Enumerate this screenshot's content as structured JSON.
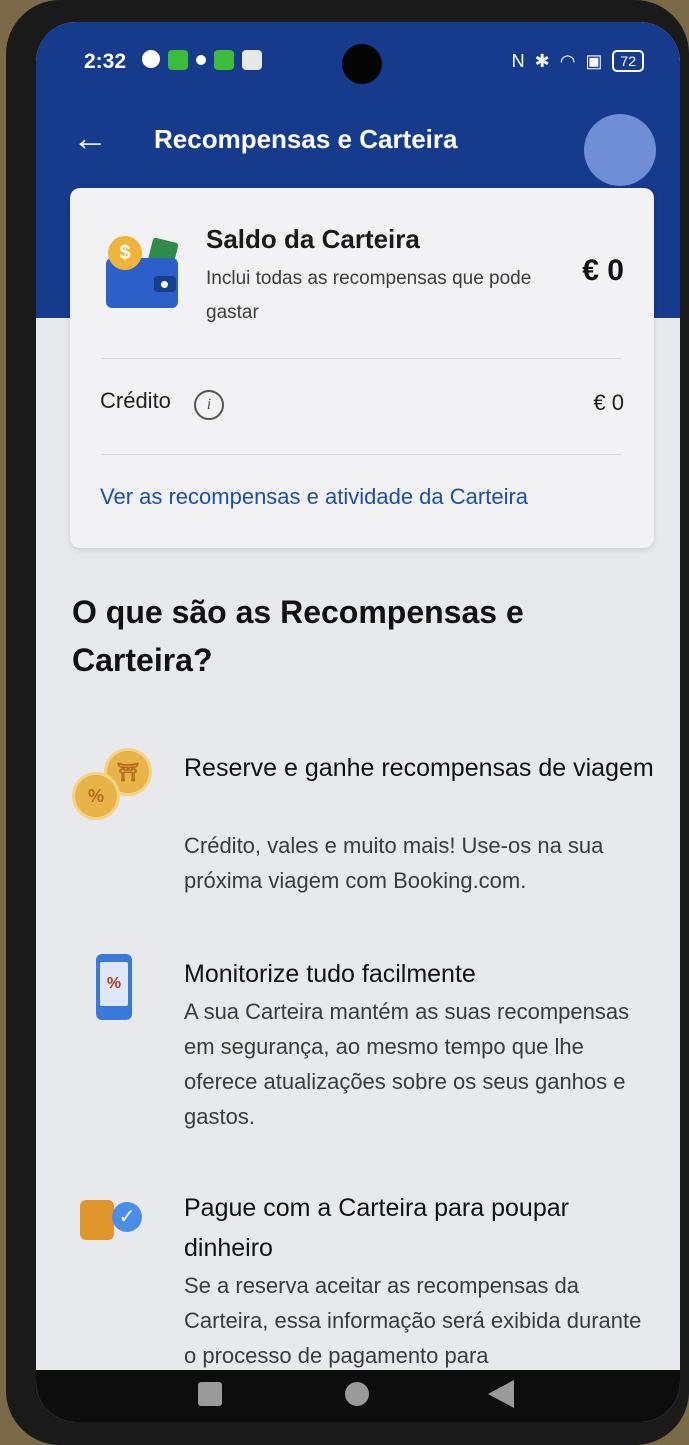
{
  "status_bar": {
    "time": "2:32",
    "battery": "72"
  },
  "app_bar": {
    "title": "Recompensas e Carteira",
    "back_icon": "arrow-left-icon"
  },
  "wallet_card": {
    "title": "Saldo da Carteira",
    "subtitle": "Inclui todas as recompensas que pode gastar",
    "amount": "€ 0",
    "credit_label": "Crédito",
    "credit_value": "€ 0",
    "link": "Ver as recompensas e atividade da Carteira"
  },
  "section": {
    "title": "O que são as Recompensas e Carteira?",
    "features": [
      {
        "icon": "coins-percent-icon",
        "title": "Reserve e ganhe recompensas de viagem",
        "description": "Crédito, vales e muito mais! Use-os na sua próxima viagem com Booking.com."
      },
      {
        "icon": "phone-percent-icon",
        "title": "Monitorize tudo facilmente",
        "description": "A sua Carteira mantém as suas recompensas em segurança, ao mesmo tempo que lhe oferece atualizações sobre os seus ganhos e gastos."
      },
      {
        "icon": "coins-check-icon",
        "title": "Pague com a Carteira para poupar dinheiro",
        "description": "Se a reserva aceitar as recompensas da Carteira, essa informação será exibida durante o processo de pagamento para"
      }
    ]
  },
  "colors": {
    "brand_blue": "#163a8c",
    "link_blue": "#1d4fa3",
    "background": "#e8e9ed"
  }
}
